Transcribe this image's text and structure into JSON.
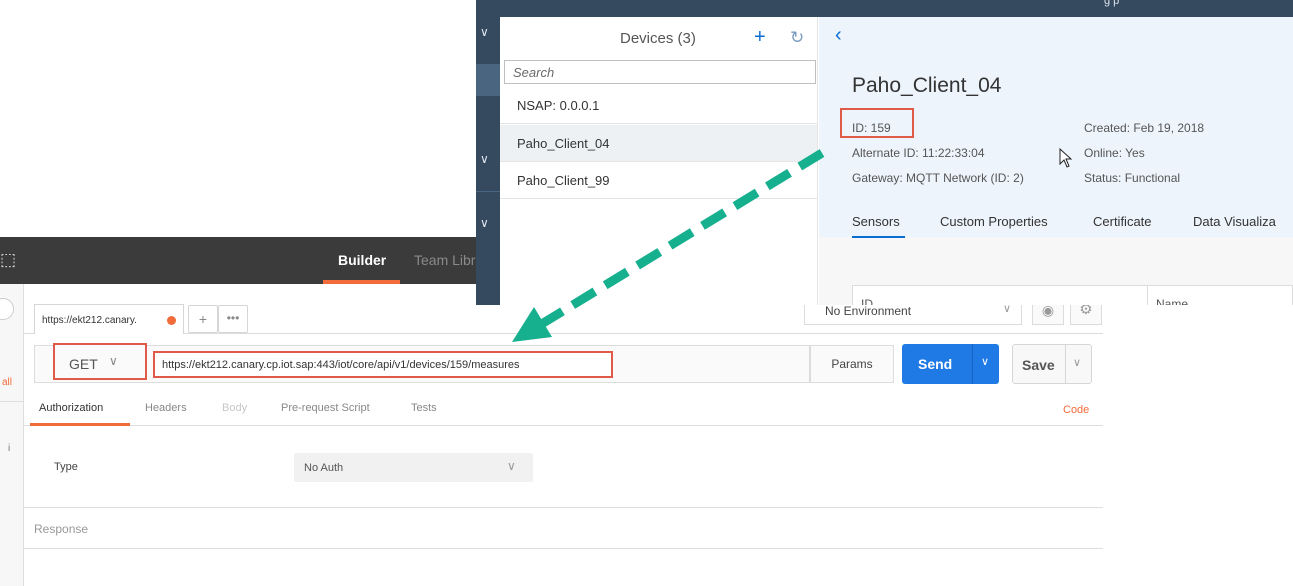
{
  "postman": {
    "topbar": {
      "builder_tab": "Builder",
      "team_library_tab": "Team Libr"
    },
    "left_edge": {
      "all_link": "all",
      "info_text": "i"
    },
    "request_tab": {
      "title": "https://ekt212.canary.",
      "add_label": "+",
      "more_label": "•••"
    },
    "environment": {
      "value": "No Environment"
    },
    "request": {
      "method": "GET",
      "url": "https://ekt212.canary.cp.iot.sap:443/iot/core/api/v1/devices/159/measures",
      "params_label": "Params",
      "send_label": "Send",
      "save_label": "Save"
    },
    "request_tabs": [
      "Authorization",
      "Headers",
      "Body",
      "Pre-request Script",
      "Tests"
    ],
    "code_link": "Code",
    "auth": {
      "type_label": "Type",
      "selected": "No Auth"
    },
    "response_label": "Response",
    "colors": {
      "accent": "#f26b3a",
      "send": "#1f7ae6",
      "highlight_box": "#e05a4a"
    }
  },
  "iot": {
    "topbar_text": "g                p",
    "device_list": {
      "title": "Devices (3)",
      "search_placeholder": "Search",
      "items": [
        "NSAP: 0.0.0.1",
        "Paho_Client_04",
        "Paho_Client_99"
      ],
      "selected_index": 1
    },
    "detail": {
      "name": "Paho_Client_04",
      "id": "ID: 159",
      "alternate_id": "Alternate ID: 11:22:33:04",
      "gateway": "Gateway: MQTT Network (ID: 2)",
      "created": "Created: Feb 19, 2018",
      "online": "Online: Yes",
      "status": "Status: Functional",
      "tabs": [
        "Sensors",
        "Custom Properties",
        "Certificate",
        "Data Visualiza"
      ],
      "table_headers": [
        "ID",
        "Name"
      ]
    },
    "colors": {
      "shell": "#354a5f",
      "accent": "#0a6ed1",
      "arrow": "#16b08f"
    }
  }
}
